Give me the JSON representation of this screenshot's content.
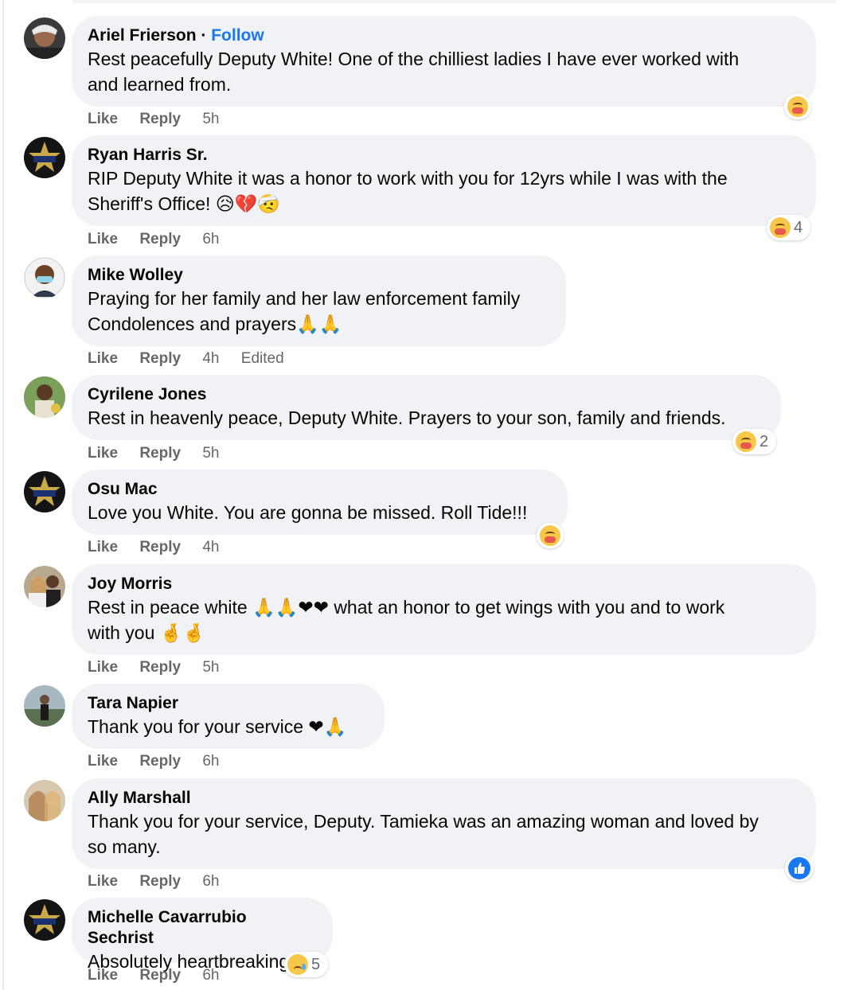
{
  "actions": {
    "like": "Like",
    "reply": "Reply"
  },
  "comments": [
    {
      "author": "Ariel Frierson",
      "follow": "Follow",
      "text_lines": [
        "Rest peacefully Deputy White! One of the chilliest ladies I have ever worked with",
        "and learned from."
      ],
      "time": "5h",
      "reaction": {
        "type": "care-icon",
        "count": ""
      }
    },
    {
      "author": "Ryan Harris Sr.",
      "text_lines": [
        "RIP Deputy White it was a honor to work with you for 12yrs while I was with the",
        "Sheriff's Office! 😥💔🤕"
      ],
      "time": "6h",
      "reaction": {
        "type": "care-icon",
        "count": "4"
      }
    },
    {
      "author": "Mike Wolley",
      "text_lines": [
        "Praying for her family and her law enforcement family",
        "Condolences and prayers🙏🙏"
      ],
      "time": "4h",
      "edited": "Edited"
    },
    {
      "author": "Cyrilene Jones",
      "text_lines": [
        "Rest in heavenly peace, Deputy White. Prayers to your son, family and friends."
      ],
      "time": "5h",
      "reaction": {
        "type": "care-icon",
        "count": "2"
      }
    },
    {
      "author": "Osu Mac",
      "text_lines": [
        "Love you White. You are gonna be missed. Roll Tide!!!"
      ],
      "time": "4h",
      "reaction": {
        "type": "care-icon",
        "count": ""
      }
    },
    {
      "author": "Joy Morris",
      "text_lines": [
        "Rest in peace white 🙏🙏❤❤ what an honor to get wings with you and to work",
        "with you 🤞🤞"
      ],
      "time": "5h"
    },
    {
      "author": "Tara Napier",
      "text_lines": [
        "Thank you for your service ❤🙏"
      ],
      "time": "6h"
    },
    {
      "author": "Ally Marshall",
      "text_lines": [
        "Thank you for your service, Deputy. Tamieka was an amazing woman and loved by",
        "so many."
      ],
      "time": "6h",
      "reaction": {
        "type": "like-icon",
        "count": ""
      }
    },
    {
      "author": "Michelle Cavarrubio Sechrist",
      "text_lines": [
        "Absolutely heartbreaking"
      ],
      "time": "6h",
      "reaction": {
        "type": "sad-icon",
        "count": "5"
      }
    }
  ]
}
